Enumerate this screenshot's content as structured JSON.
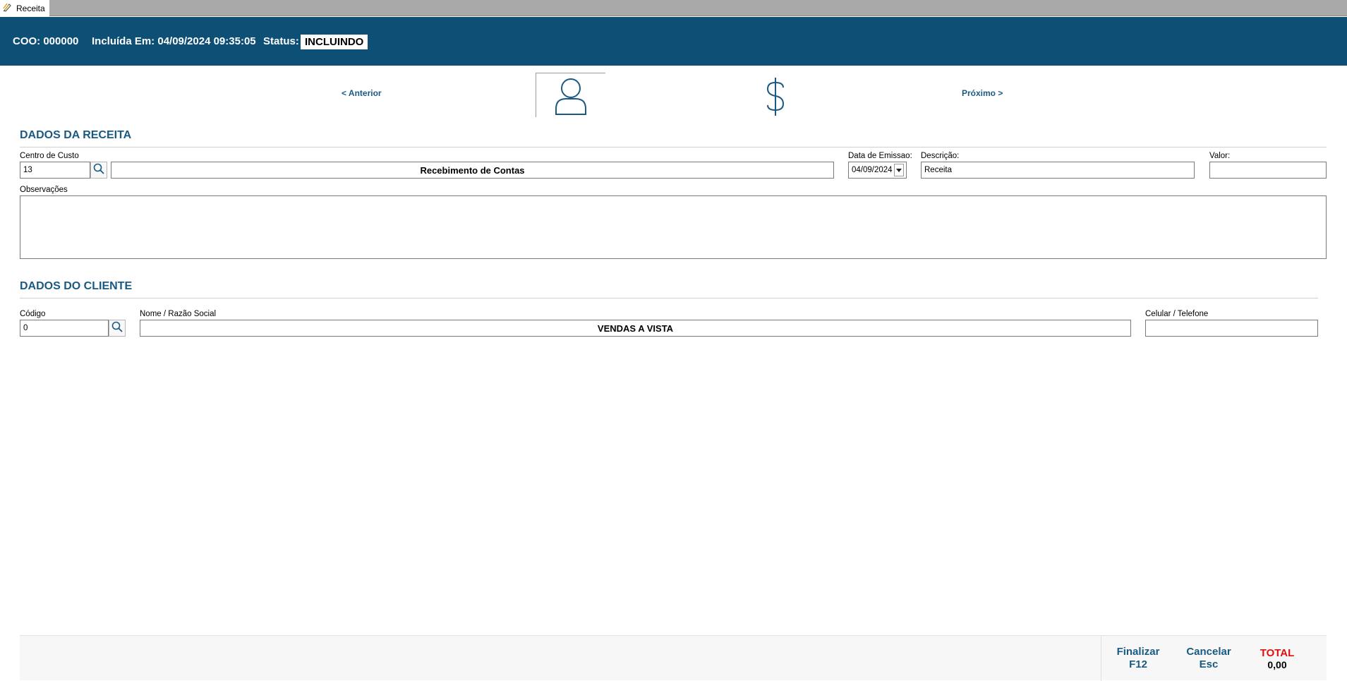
{
  "window": {
    "tab_label": "Receita",
    "icon": "receipt-pen-icon"
  },
  "header": {
    "coo": "COO: 000000",
    "included": "Incluída Em: 04/09/2024 09:35:05",
    "status_label": "Status:",
    "status_value": "INCLUINDO",
    "background": "#0e4f75"
  },
  "nav": {
    "previous": "<  Anterior",
    "next": "Próximo  >",
    "tabs": [
      {
        "icon": "person-icon",
        "active": true
      },
      {
        "icon": "dollar-icon",
        "active": false
      }
    ]
  },
  "receita": {
    "title": "DADOS DA RECEITA",
    "centro_custo_label": "Centro de Custo",
    "centro_custo_code": "13",
    "centro_custo_name": "Recebimento de Contas",
    "data_emissao_label": "Data de Emissao:",
    "data_emissao_value": "04/09/2024",
    "descricao_label": "Descrição:",
    "descricao_value": "Receita",
    "valor_label": "Valor:",
    "valor_value": "",
    "observacoes_label": "Observações",
    "observacoes_value": ""
  },
  "cliente": {
    "title": "DADOS DO CLIENTE",
    "codigo_label": "Código",
    "codigo_value": "0",
    "nome_label": "Nome / Razão Social",
    "nome_value": "VENDAS A VISTA",
    "telefone_label": "Celular / Telefone",
    "telefone_value": ""
  },
  "footer": {
    "finalizar": "Finalizar",
    "finalizar_key": "F12",
    "cancelar": "Cancelar",
    "cancelar_key": "Esc",
    "total_label": "TOTAL",
    "total_value": "0,00"
  },
  "colors": {
    "accent": "#1a5a82",
    "total_label": "#e01010"
  }
}
